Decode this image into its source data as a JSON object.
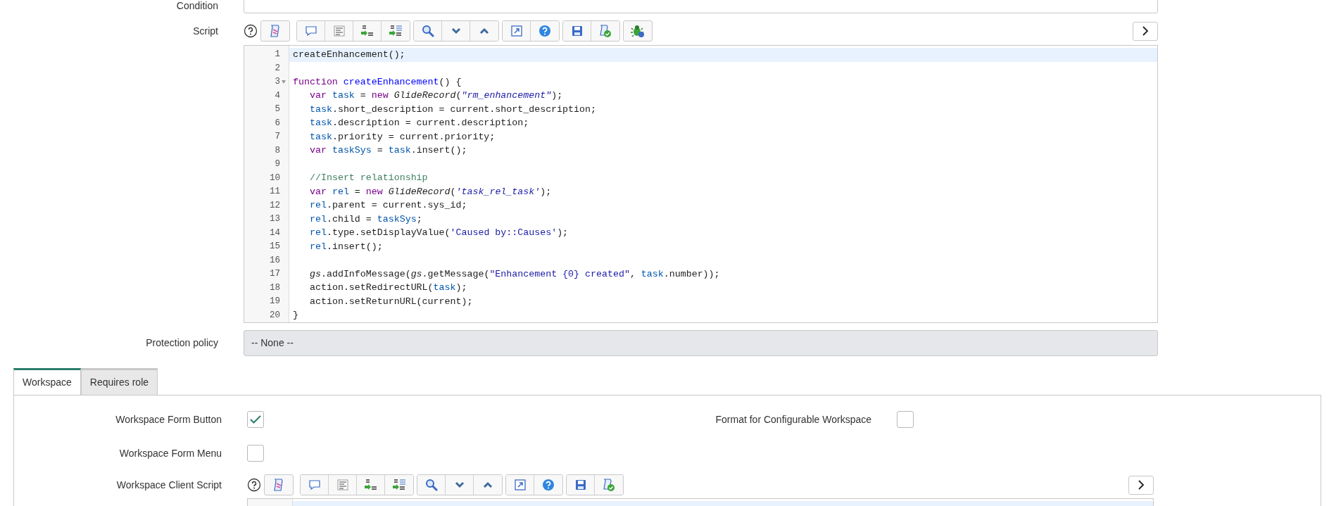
{
  "condition": {
    "label": "Condition"
  },
  "script": {
    "label": "Script",
    "toolbar": [
      {
        "buttons": [
          {
            "kind": "format"
          }
        ]
      },
      {
        "buttons": [
          {
            "kind": "comment"
          },
          {
            "kind": "align"
          },
          {
            "kind": "replace"
          },
          {
            "kind": "replace-all"
          }
        ]
      },
      {
        "buttons": [
          {
            "kind": "search"
          },
          {
            "kind": "next"
          },
          {
            "kind": "prev"
          }
        ]
      },
      {
        "buttons": [
          {
            "kind": "fullscreen"
          },
          {
            "kind": "help"
          }
        ]
      },
      {
        "buttons": [
          {
            "kind": "save"
          },
          {
            "kind": "validate"
          }
        ]
      },
      {
        "buttons": [
          {
            "kind": "debug"
          }
        ]
      }
    ],
    "lines": [
      {
        "number": "1",
        "selected": true,
        "fold": false,
        "indented": false,
        "tokens": [
          {
            "text": "createEnhancement();",
            "kind": "plain"
          }
        ]
      },
      {
        "number": "2",
        "selected": false,
        "fold": false
      },
      {
        "number": "3",
        "selected": false,
        "fold": true,
        "indented": false,
        "tokens": [
          {
            "text": "function",
            "kind": "keyword"
          },
          {
            "text": " createEnhancement",
            "kind": "def"
          },
          {
            "text": "() {",
            "kind": "plain"
          }
        ]
      },
      {
        "number": "4",
        "selected": false,
        "fold": false,
        "indented": true,
        "tokens": [
          {
            "text": "var",
            "kind": "keyword"
          },
          {
            "text": " task",
            "kind": "variable"
          },
          {
            "text": " = ",
            "kind": "plain"
          },
          {
            "text": "new",
            "kind": "keyword"
          },
          {
            "text": " GlideRecord",
            "kind": "type"
          },
          {
            "text": "(",
            "kind": "plain"
          },
          {
            "text": "\"rm_enhancement\"",
            "kind": "string-em"
          },
          {
            "text": ");",
            "kind": "plain"
          }
        ]
      },
      {
        "number": "5",
        "selected": false,
        "fold": false,
        "indented": true,
        "tokens": [
          {
            "text": "task",
            "kind": "variable"
          },
          {
            "text": ".short_description = current.short_description;",
            "kind": "plain"
          }
        ]
      },
      {
        "number": "6",
        "selected": false,
        "fold": false,
        "indented": true,
        "tokens": [
          {
            "text": "task",
            "kind": "variable"
          },
          {
            "text": ".description = current.description;",
            "kind": "plain"
          }
        ]
      },
      {
        "number": "7",
        "selected": false,
        "fold": false,
        "indented": true,
        "tokens": [
          {
            "text": "task",
            "kind": "variable"
          },
          {
            "text": ".priority = current.priority;",
            "kind": "plain"
          }
        ]
      },
      {
        "number": "8",
        "selected": false,
        "fold": false,
        "indented": true,
        "tokens": [
          {
            "text": "var",
            "kind": "keyword"
          },
          {
            "text": " taskSys",
            "kind": "variable"
          },
          {
            "text": " = ",
            "kind": "plain"
          },
          {
            "text": "task",
            "kind": "variable"
          },
          {
            "text": ".insert();",
            "kind": "plain"
          }
        ]
      },
      {
        "number": "9",
        "selected": false,
        "fold": false
      },
      {
        "number": "10",
        "selected": false,
        "fold": false,
        "indented": true,
        "tokens": [
          {
            "text": "//Insert relationship",
            "kind": "comment"
          }
        ]
      },
      {
        "number": "11",
        "selected": false,
        "fold": false,
        "indented": true,
        "tokens": [
          {
            "text": "var",
            "kind": "keyword"
          },
          {
            "text": " rel",
            "kind": "variable"
          },
          {
            "text": " = ",
            "kind": "plain"
          },
          {
            "text": "new",
            "kind": "keyword"
          },
          {
            "text": " GlideRecord",
            "kind": "type"
          },
          {
            "text": "(",
            "kind": "plain"
          },
          {
            "text": "'task_rel_task'",
            "kind": "string-em"
          },
          {
            "text": ");",
            "kind": "plain"
          }
        ]
      },
      {
        "number": "12",
        "selected": false,
        "fold": false,
        "indented": true,
        "tokens": [
          {
            "text": "rel",
            "kind": "variable"
          },
          {
            "text": ".parent = current.sys_id;",
            "kind": "plain"
          }
        ]
      },
      {
        "number": "13",
        "selected": false,
        "fold": false,
        "indented": true,
        "tokens": [
          {
            "text": "rel",
            "kind": "variable"
          },
          {
            "text": ".child = ",
            "kind": "plain"
          },
          {
            "text": "taskSys",
            "kind": "variable"
          },
          {
            "text": ";",
            "kind": "plain"
          }
        ]
      },
      {
        "number": "14",
        "selected": false,
        "fold": false,
        "indented": true,
        "tokens": [
          {
            "text": "rel",
            "kind": "variable"
          },
          {
            "text": ".type.setDisplayValue(",
            "kind": "plain"
          },
          {
            "text": "'Caused by::Causes'",
            "kind": "string"
          },
          {
            "text": ");",
            "kind": "plain"
          }
        ]
      },
      {
        "number": "15",
        "selected": false,
        "fold": false,
        "indented": true,
        "tokens": [
          {
            "text": "rel",
            "kind": "variable"
          },
          {
            "text": ".insert();",
            "kind": "plain"
          }
        ]
      },
      {
        "number": "16",
        "selected": false,
        "fold": false
      },
      {
        "number": "17",
        "selected": false,
        "fold": false,
        "indented": true,
        "tokens": [
          {
            "text": "gs",
            "kind": "type"
          },
          {
            "text": ".addInfoMessage(",
            "kind": "plain"
          },
          {
            "text": "gs",
            "kind": "type"
          },
          {
            "text": ".getMessage(",
            "kind": "plain"
          },
          {
            "text": "\"Enhancement {0} created\"",
            "kind": "string"
          },
          {
            "text": ", ",
            "kind": "plain"
          },
          {
            "text": "task",
            "kind": "variable"
          },
          {
            "text": ".number));",
            "kind": "plain"
          }
        ]
      },
      {
        "number": "18",
        "selected": false,
        "fold": false,
        "indented": true,
        "tokens": [
          {
            "text": "action.setRedirectURL(",
            "kind": "plain"
          },
          {
            "text": "task",
            "kind": "variable"
          },
          {
            "text": ");",
            "kind": "plain"
          }
        ]
      },
      {
        "number": "19",
        "selected": false,
        "fold": false,
        "indented": true,
        "tokens": [
          {
            "text": "action.setReturnURL(current);",
            "kind": "plain"
          }
        ]
      },
      {
        "number": "20",
        "selected": false,
        "fold": false,
        "indented": false,
        "tokens": [
          {
            "text": "}",
            "kind": "plain"
          }
        ]
      }
    ]
  },
  "protection_policy": {
    "label": "Protection policy",
    "value": "-- None --"
  },
  "tabs": [
    {
      "label": "Workspace",
      "selected": true
    },
    {
      "label": "Requires role",
      "selected": false
    }
  ],
  "workspace": {
    "fields": [
      {
        "label": "Workspace Form Button",
        "kind": "checkbox",
        "checked": true
      },
      {
        "label": "Format for Configurable Workspace",
        "kind": "checkbox",
        "checked": false
      },
      {
        "label": "Workspace Form Menu",
        "kind": "checkbox",
        "checked": false
      },
      {
        "label": "Workspace Client Script",
        "kind": "script",
        "toolbar": [
          {
            "buttons": [
              {
                "kind": "format"
              }
            ]
          },
          {
            "buttons": [
              {
                "kind": "comment"
              },
              {
                "kind": "align"
              },
              {
                "kind": "replace"
              },
              {
                "kind": "replace-all"
              }
            ]
          },
          {
            "buttons": [
              {
                "kind": "search"
              },
              {
                "kind": "next"
              },
              {
                "kind": "prev"
              }
            ]
          },
          {
            "buttons": [
              {
                "kind": "fullscreen"
              },
              {
                "kind": "help"
              }
            ]
          },
          {
            "buttons": [
              {
                "kind": "save"
              },
              {
                "kind": "validate"
              }
            ]
          }
        ]
      }
    ]
  }
}
